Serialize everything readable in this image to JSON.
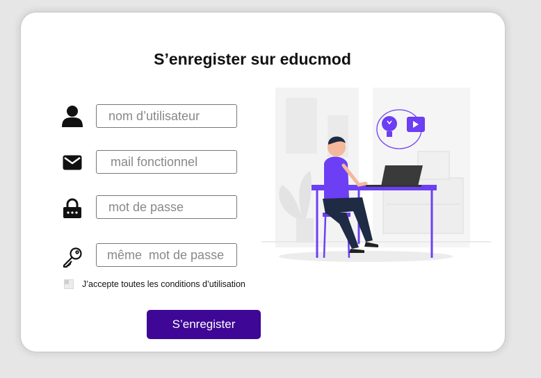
{
  "form": {
    "title": "S’enregister sur educmod",
    "fields": [
      {
        "icon": "user-icon",
        "placeholder": "nom d’utilisateur"
      },
      {
        "icon": "mail-icon",
        "placeholder": "mail fonctionnel"
      },
      {
        "icon": "lock-icon",
        "placeholder": "mot de passe"
      },
      {
        "icon": "key-icon",
        "placeholder": "même  mot de passe"
      }
    ],
    "terms_label": "J’accepte toutes les conditions d’utilisation",
    "terms_checked": false,
    "submit_label": "S’enregister"
  },
  "colors": {
    "accent": "#3e0795",
    "illustration_accent": "#6c3ef4",
    "background": "#e6e6e6",
    "card": "#ffffff"
  }
}
